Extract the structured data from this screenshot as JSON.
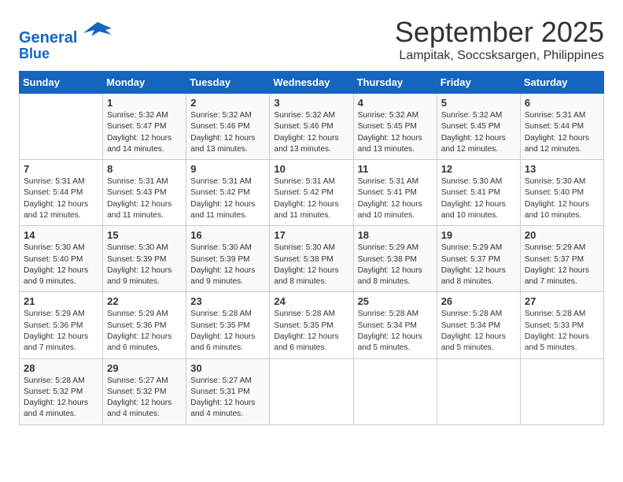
{
  "logo": {
    "line1": "General",
    "line2": "Blue"
  },
  "title": "September 2025",
  "location": "Lampitak, Soccsksargen, Philippines",
  "weekdays": [
    "Sunday",
    "Monday",
    "Tuesday",
    "Wednesday",
    "Thursday",
    "Friday",
    "Saturday"
  ],
  "weeks": [
    [
      null,
      {
        "day": 1,
        "sunrise": "Sunrise: 5:32 AM",
        "sunset": "Sunset: 5:47 PM",
        "daylight": "Daylight: 12 hours and 14 minutes."
      },
      {
        "day": 2,
        "sunrise": "Sunrise: 5:32 AM",
        "sunset": "Sunset: 5:46 PM",
        "daylight": "Daylight: 12 hours and 13 minutes."
      },
      {
        "day": 3,
        "sunrise": "Sunrise: 5:32 AM",
        "sunset": "Sunset: 5:46 PM",
        "daylight": "Daylight: 12 hours and 13 minutes."
      },
      {
        "day": 4,
        "sunrise": "Sunrise: 5:32 AM",
        "sunset": "Sunset: 5:45 PM",
        "daylight": "Daylight: 12 hours and 13 minutes."
      },
      {
        "day": 5,
        "sunrise": "Sunrise: 5:32 AM",
        "sunset": "Sunset: 5:45 PM",
        "daylight": "Daylight: 12 hours and 12 minutes."
      },
      {
        "day": 6,
        "sunrise": "Sunrise: 5:31 AM",
        "sunset": "Sunset: 5:44 PM",
        "daylight": "Daylight: 12 hours and 12 minutes."
      }
    ],
    [
      {
        "day": 7,
        "sunrise": "Sunrise: 5:31 AM",
        "sunset": "Sunset: 5:44 PM",
        "daylight": "Daylight: 12 hours and 12 minutes."
      },
      {
        "day": 8,
        "sunrise": "Sunrise: 5:31 AM",
        "sunset": "Sunset: 5:43 PM",
        "daylight": "Daylight: 12 hours and 11 minutes."
      },
      {
        "day": 9,
        "sunrise": "Sunrise: 5:31 AM",
        "sunset": "Sunset: 5:42 PM",
        "daylight": "Daylight: 12 hours and 11 minutes."
      },
      {
        "day": 10,
        "sunrise": "Sunrise: 5:31 AM",
        "sunset": "Sunset: 5:42 PM",
        "daylight": "Daylight: 12 hours and 11 minutes."
      },
      {
        "day": 11,
        "sunrise": "Sunrise: 5:31 AM",
        "sunset": "Sunset: 5:41 PM",
        "daylight": "Daylight: 12 hours and 10 minutes."
      },
      {
        "day": 12,
        "sunrise": "Sunrise: 5:30 AM",
        "sunset": "Sunset: 5:41 PM",
        "daylight": "Daylight: 12 hours and 10 minutes."
      },
      {
        "day": 13,
        "sunrise": "Sunrise: 5:30 AM",
        "sunset": "Sunset: 5:40 PM",
        "daylight": "Daylight: 12 hours and 10 minutes."
      }
    ],
    [
      {
        "day": 14,
        "sunrise": "Sunrise: 5:30 AM",
        "sunset": "Sunset: 5:40 PM",
        "daylight": "Daylight: 12 hours and 9 minutes."
      },
      {
        "day": 15,
        "sunrise": "Sunrise: 5:30 AM",
        "sunset": "Sunset: 5:39 PM",
        "daylight": "Daylight: 12 hours and 9 minutes."
      },
      {
        "day": 16,
        "sunrise": "Sunrise: 5:30 AM",
        "sunset": "Sunset: 5:39 PM",
        "daylight": "Daylight: 12 hours and 9 minutes."
      },
      {
        "day": 17,
        "sunrise": "Sunrise: 5:30 AM",
        "sunset": "Sunset: 5:38 PM",
        "daylight": "Daylight: 12 hours and 8 minutes."
      },
      {
        "day": 18,
        "sunrise": "Sunrise: 5:29 AM",
        "sunset": "Sunset: 5:38 PM",
        "daylight": "Daylight: 12 hours and 8 minutes."
      },
      {
        "day": 19,
        "sunrise": "Sunrise: 5:29 AM",
        "sunset": "Sunset: 5:37 PM",
        "daylight": "Daylight: 12 hours and 8 minutes."
      },
      {
        "day": 20,
        "sunrise": "Sunrise: 5:29 AM",
        "sunset": "Sunset: 5:37 PM",
        "daylight": "Daylight: 12 hours and 7 minutes."
      }
    ],
    [
      {
        "day": 21,
        "sunrise": "Sunrise: 5:29 AM",
        "sunset": "Sunset: 5:36 PM",
        "daylight": "Daylight: 12 hours and 7 minutes."
      },
      {
        "day": 22,
        "sunrise": "Sunrise: 5:29 AM",
        "sunset": "Sunset: 5:36 PM",
        "daylight": "Daylight: 12 hours and 6 minutes."
      },
      {
        "day": 23,
        "sunrise": "Sunrise: 5:28 AM",
        "sunset": "Sunset: 5:35 PM",
        "daylight": "Daylight: 12 hours and 6 minutes."
      },
      {
        "day": 24,
        "sunrise": "Sunrise: 5:28 AM",
        "sunset": "Sunset: 5:35 PM",
        "daylight": "Daylight: 12 hours and 6 minutes."
      },
      {
        "day": 25,
        "sunrise": "Sunrise: 5:28 AM",
        "sunset": "Sunset: 5:34 PM",
        "daylight": "Daylight: 12 hours and 5 minutes."
      },
      {
        "day": 26,
        "sunrise": "Sunrise: 5:28 AM",
        "sunset": "Sunset: 5:34 PM",
        "daylight": "Daylight: 12 hours and 5 minutes."
      },
      {
        "day": 27,
        "sunrise": "Sunrise: 5:28 AM",
        "sunset": "Sunset: 5:33 PM",
        "daylight": "Daylight: 12 hours and 5 minutes."
      }
    ],
    [
      {
        "day": 28,
        "sunrise": "Sunrise: 5:28 AM",
        "sunset": "Sunset: 5:32 PM",
        "daylight": "Daylight: 12 hours and 4 minutes."
      },
      {
        "day": 29,
        "sunrise": "Sunrise: 5:27 AM",
        "sunset": "Sunset: 5:32 PM",
        "daylight": "Daylight: 12 hours and 4 minutes."
      },
      {
        "day": 30,
        "sunrise": "Sunrise: 5:27 AM",
        "sunset": "Sunset: 5:31 PM",
        "daylight": "Daylight: 12 hours and 4 minutes."
      },
      null,
      null,
      null,
      null
    ]
  ]
}
